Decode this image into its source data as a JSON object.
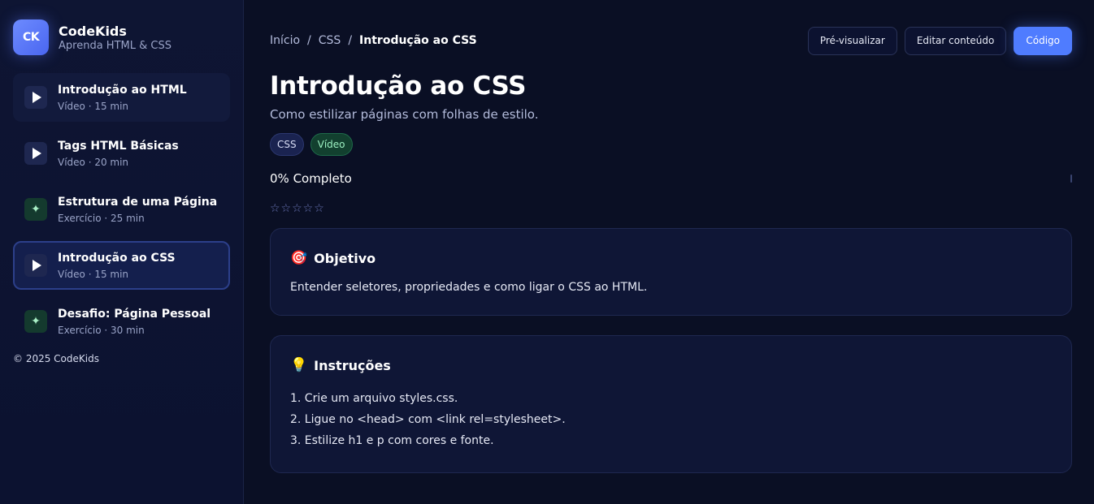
{
  "brand": {
    "logo_text": "CK",
    "name": "CodeKids",
    "subtitle": "Aprenda HTML & CSS"
  },
  "sidebar": {
    "lessons": [
      {
        "title": "Introdução ao HTML",
        "meta": "Vídeo · 15 min",
        "kind": "video"
      },
      {
        "title": "Tags HTML Básicas",
        "meta": "Vídeo · 20 min",
        "kind": "video"
      },
      {
        "title": "Estrutura de uma Página",
        "meta": "Exercício · 25 min",
        "kind": "exercise"
      },
      {
        "title": "Introdução ao CSS",
        "meta": "Vídeo · 15 min",
        "kind": "video",
        "active": true
      },
      {
        "title": "Desafio: Página Pessoal",
        "meta": "Exercício · 30 min",
        "kind": "exercise"
      }
    ],
    "copyright": "© 2025 CodeKids"
  },
  "breadcrumb": {
    "home": "Início",
    "section": "CSS",
    "current": "Introdução ao CSS",
    "separator": "/"
  },
  "actions": {
    "preview": "Pré-visualizar",
    "edit": "Editar conteúdo",
    "code": "Código"
  },
  "lesson": {
    "title": "Introdução ao CSS",
    "subtitle": "Como estilizar páginas com folhas de estilo.",
    "tags": [
      "CSS",
      "Vídeo"
    ],
    "progress_label": "0% Completo",
    "progress": 0,
    "stars": "☆☆☆☆☆",
    "rating": 0
  },
  "objective": {
    "icon": "🎯",
    "title": "Objetivo",
    "text": "Entender seletores, propriedades e como ligar o CSS ao HTML."
  },
  "instructions": {
    "icon": "💡",
    "title": "Instruções",
    "steps": [
      "1. Crie um arquivo styles.css.",
      "2. Ligue no <head> com <link rel=stylesheet>.",
      "3. Estilize h1 e p com cores e fonte."
    ]
  },
  "colors": {
    "accent": "#4f7cff",
    "background": "#0a0f24",
    "exercise": "#143a2e"
  }
}
